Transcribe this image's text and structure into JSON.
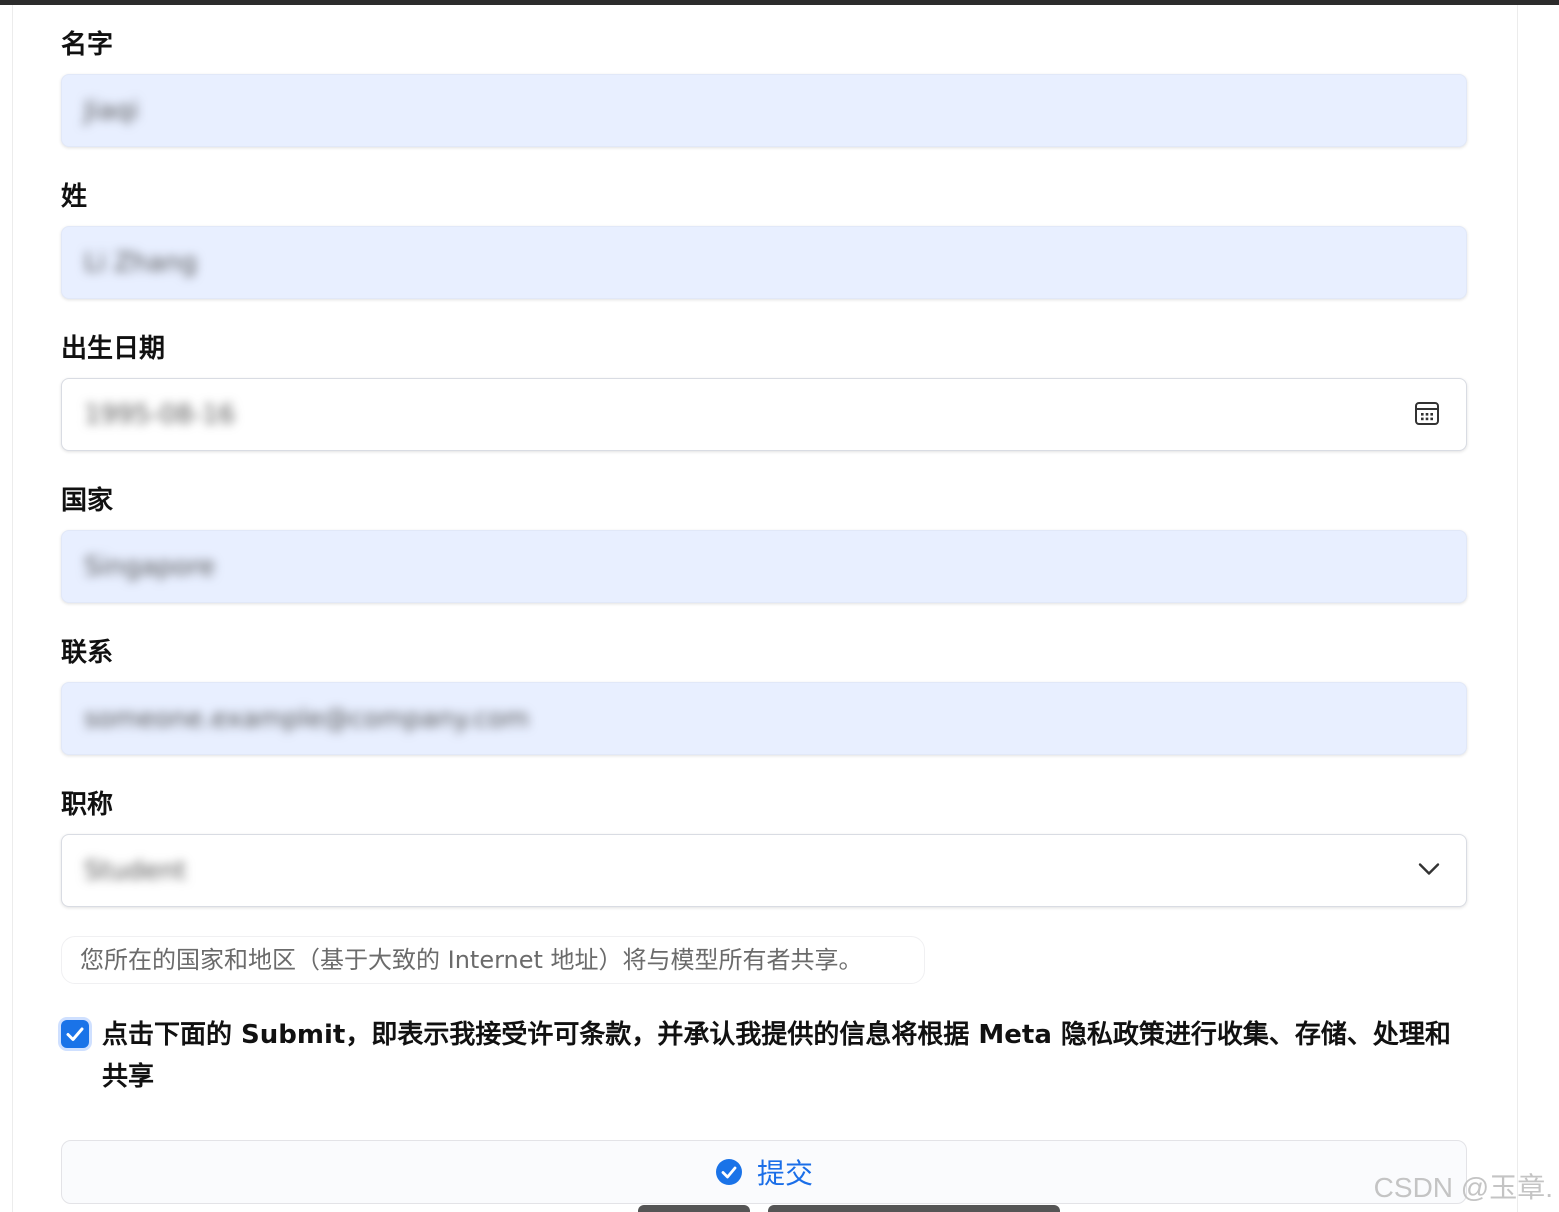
{
  "form": {
    "first_name": {
      "label": "名字",
      "value": "Jiaqi"
    },
    "last_name": {
      "label": "姓",
      "value": "Li Zhang"
    },
    "birth_date": {
      "label": "出生日期",
      "value": "1995-08-16"
    },
    "country": {
      "label": "国家",
      "value": "Singapore"
    },
    "contact": {
      "label": "联系",
      "value": "someone.example@company.com"
    },
    "job_title": {
      "label": "职称",
      "value": "Student"
    }
  },
  "notice": "您所在的国家和地区（基于大致的 Internet 地址）将与模型所有者共享。",
  "consent": {
    "checked": true,
    "text": "点击下面的 Submit，即表示我接受许可条款，并承认我提供的信息将根据 Meta 隐私政策进行收集、存储、处理和共享"
  },
  "submit": {
    "label": "提交"
  },
  "watermark": "CSDN @玉章.",
  "colors": {
    "accent": "#1a73e8",
    "field_fill": "#e8efff"
  },
  "icons": {
    "date": "calendar-icon",
    "select": "chevron-down-icon",
    "submit": "check-circle-icon"
  }
}
